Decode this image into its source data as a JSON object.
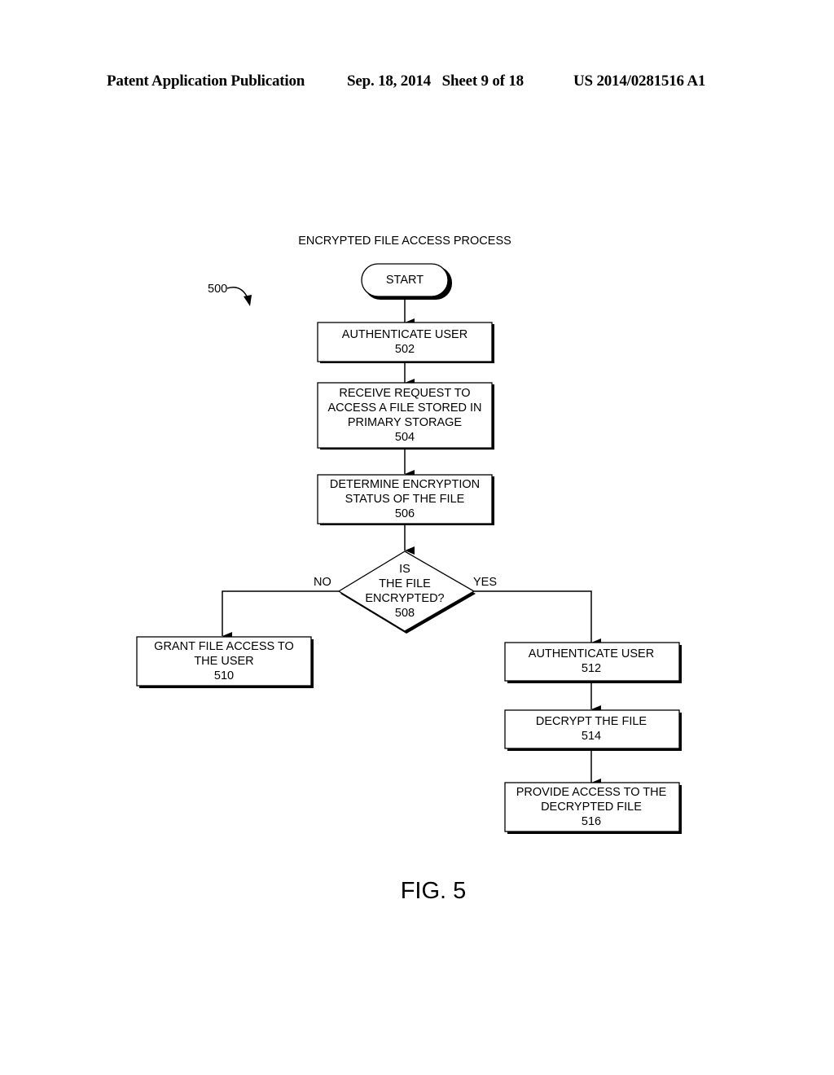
{
  "header": {
    "publication": "Patent Application Publication",
    "date_sheet": "Sep. 18, 2014   Sheet 9 of 18",
    "pub_number": "US 2014/0281516 A1"
  },
  "diagram": {
    "title": "ENCRYPTED FILE ACCESS PROCESS",
    "ref_label": "500",
    "start_label": "START",
    "nodes": {
      "n502": [
        "AUTHENTICATE USER",
        "502"
      ],
      "n504": [
        "RECEIVE REQUEST TO",
        "ACCESS A FILE STORED IN",
        "PRIMARY STORAGE",
        "504"
      ],
      "n506": [
        "DETERMINE ENCRYPTION",
        "STATUS OF THE FILE",
        "506"
      ],
      "n508": [
        "IS",
        "THE FILE",
        "ENCRYPTED?",
        "508"
      ],
      "n510": [
        "GRANT FILE ACCESS TO",
        "THE USER",
        "510"
      ],
      "n512": [
        "AUTHENTICATE USER",
        "512"
      ],
      "n514": [
        "DECRYPT THE FILE",
        "514"
      ],
      "n516": [
        "PROVIDE ACCESS TO THE",
        "DECRYPTED FILE",
        "516"
      ]
    },
    "branch_no": "NO",
    "branch_yes": "YES",
    "figure_label": "FIG. 5"
  }
}
